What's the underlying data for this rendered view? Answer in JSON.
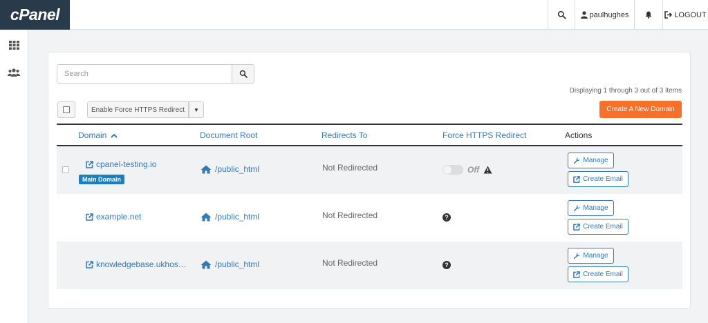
{
  "app": {
    "logo_text": "cPanel"
  },
  "topbar": {
    "username": "paulhughes",
    "logout_label": "LOGOUT",
    "icons": [
      "search-icon",
      "user-icon",
      "bell-icon",
      "logout-icon"
    ]
  },
  "sidebar": {
    "items": [
      {
        "icon": "grid-icon"
      },
      {
        "icon": "users-icon"
      }
    ]
  },
  "toolbar": {
    "search_placeholder": "Search",
    "display_info": "Displaying 1 through 3 out of 3 items",
    "bulk_action_label": "Enable Force HTTPS Redirect",
    "create_label": "Create A New Domain"
  },
  "table": {
    "headers": {
      "domain": "Domain",
      "document_root": "Document Root",
      "redirects_to": "Redirects To",
      "force_https": "Force HTTPS Redirect",
      "actions": "Actions"
    },
    "rows": [
      {
        "domain": "cpanel-testing.io",
        "badge": "Main Domain",
        "document_root": "/public_html",
        "redirects_to": "Not Redirected",
        "force_https": "Off",
        "manage_label": "Manage",
        "create_email_label": "Create Email"
      },
      {
        "domain": "example.net",
        "document_root": "/public_html",
        "redirects_to": "Not Redirected",
        "force_https": "",
        "manage_label": "Manage",
        "create_email_label": "Create Email"
      },
      {
        "domain": "knowledgebase.ukhos…",
        "document_root": "/public_html",
        "redirects_to": "Not Redirected",
        "force_https": "",
        "manage_label": "Manage",
        "create_email_label": "Create Email"
      }
    ]
  },
  "colors": {
    "brand_dark": "#293a4a",
    "accent_orange": "#f9702a",
    "link_blue": "#337ab7",
    "badge_blue": "#1a7fc1"
  }
}
